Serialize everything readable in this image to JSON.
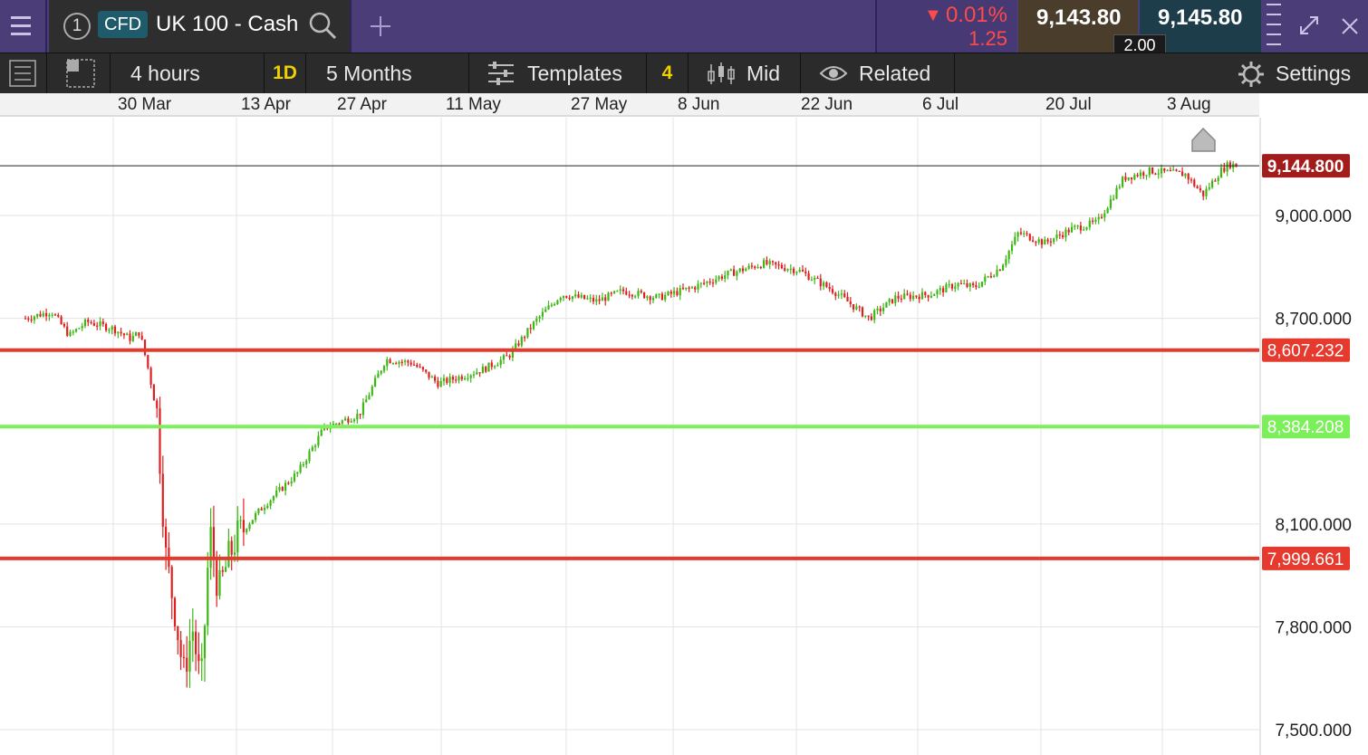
{
  "header": {
    "menu_icon": "hamburger-icon",
    "instrument_number": "1",
    "instrument_type": "CFD",
    "instrument_name": "UK 100 - Cash",
    "search_icon": "search-icon",
    "add_tab_icon": "plus-icon",
    "change_percent": "0.01%",
    "change_points": "1.25",
    "change_direction": "down",
    "sell_price": "9,143.80",
    "buy_price": "9,145.80",
    "spread": "2.00",
    "expand_icon": "expand-icon",
    "close_icon": "close-icon"
  },
  "toolbar": {
    "interval": "4 hours",
    "interval_badge": "1D",
    "range": "5 Months",
    "templates_label": "Templates",
    "templates_count": "4",
    "price_type": "Mid",
    "related_label": "Related",
    "settings_label": "Settings"
  },
  "dates": [
    "30 Mar",
    "13 Apr",
    "27 Apr",
    "11 May",
    "27 May",
    "8 Jun",
    "22 Jun",
    "6 Jul",
    "20 Jul",
    "3 Aug"
  ],
  "colors": {
    "header_bg": "#4a3d78",
    "toolbar_bg": "#2b2b2b",
    "sell_bg": "#4a3d2c",
    "buy_bg": "#1e3d4a",
    "badge_yellow": "#f0d000",
    "change_red": "#ff4a4a",
    "up_candle": "#3cb815",
    "down_candle": "#e02020",
    "current_price_bg": "#a31c1c",
    "resistance_line": "#e63a2e",
    "support_line": "#7cf05a"
  },
  "chart_data": {
    "type": "candlestick",
    "instrument": "UK 100 - Cash",
    "interval": "4 hours",
    "y_ticks": [
      9000,
      8700,
      8100,
      7800,
      7500
    ],
    "y_tick_labels": [
      "9,000.000",
      "8,700.000",
      "8,100.000",
      "7,800.000",
      "7,500.000"
    ],
    "current_price": 9144.8,
    "current_price_label": "9,144.800",
    "horizontal_lines": [
      {
        "value": 8607.232,
        "label": "8,607.232",
        "color": "#e63a2e"
      },
      {
        "value": 8384.208,
        "label": "8,384.208",
        "color": "#7cf05a"
      },
      {
        "value": 7999.661,
        "label": "7,999.661",
        "color": "#e63a2e"
      }
    ],
    "x_ticks": [
      "30 Mar",
      "13 Apr",
      "27 Apr",
      "11 May",
      "27 May",
      "8 Jun",
      "22 Jun",
      "6 Jul",
      "20 Jul",
      "3 Aug"
    ],
    "price_path": [
      [
        "2025-03-20",
        8700
      ],
      [
        "2025-03-23",
        8720
      ],
      [
        "2025-03-25",
        8650
      ],
      [
        "2025-03-27",
        8690
      ],
      [
        "2025-03-30",
        8670
      ],
      [
        "2025-04-01",
        8640
      ],
      [
        "2025-04-02",
        8660
      ],
      [
        "2025-04-03",
        8550
      ],
      [
        "2025-04-04",
        8420
      ],
      [
        "2025-04-05",
        8000
      ],
      [
        "2025-04-06",
        7850
      ],
      [
        "2025-04-07",
        7660
      ],
      [
        "2025-04-08",
        7800
      ],
      [
        "2025-04-09",
        7620
      ],
      [
        "2025-04-10",
        8080
      ],
      [
        "2025-04-11",
        7900
      ],
      [
        "2025-04-12",
        7990
      ],
      [
        "2025-04-13",
        8060
      ],
      [
        "2025-04-16",
        8150
      ],
      [
        "2025-04-20",
        8250
      ],
      [
        "2025-04-23",
        8380
      ],
      [
        "2025-04-27",
        8420
      ],
      [
        "2025-04-30",
        8580
      ],
      [
        "2025-05-03",
        8570
      ],
      [
        "2025-05-06",
        8510
      ],
      [
        "2025-05-11",
        8550
      ],
      [
        "2025-05-14",
        8590
      ],
      [
        "2025-05-17",
        8690
      ],
      [
        "2025-05-20",
        8770
      ],
      [
        "2025-05-24",
        8750
      ],
      [
        "2025-05-27",
        8780
      ],
      [
        "2025-05-31",
        8760
      ],
      [
        "2025-06-04",
        8790
      ],
      [
        "2025-06-08",
        8830
      ],
      [
        "2025-06-12",
        8860
      ],
      [
        "2025-06-16",
        8840
      ],
      [
        "2025-06-20",
        8780
      ],
      [
        "2025-06-22",
        8740
      ],
      [
        "2025-06-24",
        8700
      ],
      [
        "2025-06-27",
        8760
      ],
      [
        "2025-07-01",
        8770
      ],
      [
        "2025-07-04",
        8800
      ],
      [
        "2025-07-06",
        8790
      ],
      [
        "2025-07-09",
        8850
      ],
      [
        "2025-07-11",
        8950
      ],
      [
        "2025-07-14",
        8920
      ],
      [
        "2025-07-17",
        8960
      ],
      [
        "2025-07-20",
        8980
      ],
      [
        "2025-07-23",
        9110
      ],
      [
        "2025-07-26",
        9130
      ],
      [
        "2025-07-30",
        9120
      ],
      [
        "2025-08-01",
        9060
      ],
      [
        "2025-08-03",
        9130
      ],
      [
        "2025-08-04",
        9150
      ],
      [
        "2025-08-05",
        9144.8
      ]
    ]
  }
}
